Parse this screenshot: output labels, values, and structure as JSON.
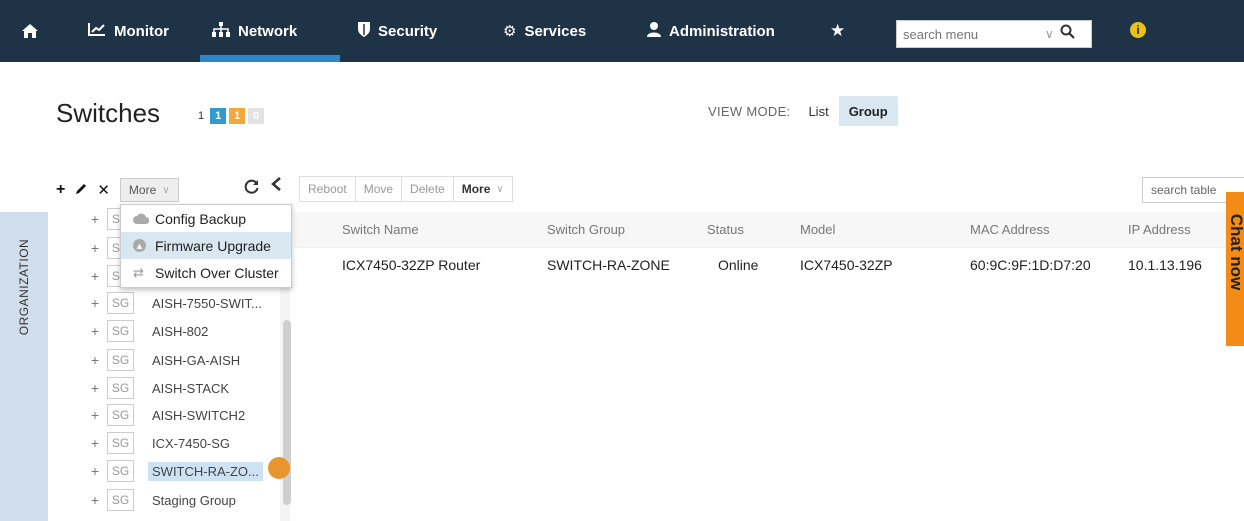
{
  "nav": {
    "home_icon": "home-icon",
    "items": [
      {
        "label": "Monitor",
        "icon": "line-chart-icon"
      },
      {
        "label": "Network",
        "icon": "sitemap-icon"
      },
      {
        "label": "Security",
        "icon": "shield-icon"
      },
      {
        "label": "Services",
        "icon": "gears-icon"
      },
      {
        "label": "Administration",
        "icon": "user-icon"
      }
    ],
    "favorites_icon": "star-icon",
    "search_placeholder": "search menu",
    "info_icon": "info-icon",
    "active": "Network"
  },
  "header": {
    "title": "Switches",
    "counts": [
      "1",
      "1",
      "1",
      "0"
    ],
    "view_mode_label": "VIEW MODE:",
    "view_modes": [
      "List",
      "Group"
    ],
    "selected_view_mode": "Group"
  },
  "left_toolbar": {
    "more_label": "More"
  },
  "menu": {
    "items": [
      {
        "label": "Config Backup",
        "icon": "cloud-icon"
      },
      {
        "label": "Firmware Upgrade",
        "icon": "upgrade-circle-icon"
      },
      {
        "label": "Switch Over Cluster",
        "icon": "switch-arrows-icon"
      }
    ],
    "highlighted": "Firmware Upgrade"
  },
  "sidebar": {
    "tab_label": "ORGANIZATION",
    "tree": [
      {
        "badge": "SG",
        "name": ""
      },
      {
        "badge": "SG",
        "name": ""
      },
      {
        "badge": "SG",
        "name": ""
      },
      {
        "badge": "SG",
        "name": "AISH-7550-SWIT..."
      },
      {
        "badge": "SG",
        "name": "AISH-802"
      },
      {
        "badge": "SG",
        "name": "AISH-GA-AISH"
      },
      {
        "badge": "SG",
        "name": "AISH-STACK"
      },
      {
        "badge": "SG",
        "name": "AISH-SWITCH2"
      },
      {
        "badge": "SG",
        "name": "ICX-7450-SG"
      },
      {
        "badge": "SG",
        "name": "SWITCH-RA-ZO..."
      },
      {
        "badge": "SG",
        "name": "Staging Group"
      }
    ],
    "selected": "SWITCH-RA-ZO..."
  },
  "right_toolbar": {
    "buttons": [
      "Reboot",
      "Move",
      "Delete"
    ],
    "more_label": "More",
    "search_placeholder": "search table"
  },
  "table": {
    "columns": [
      "Switch Name",
      "Switch Group",
      "Status",
      "Model",
      "MAC Address",
      "IP Address"
    ],
    "rows": [
      [
        "ICX7450-32ZP Router",
        "SWITCH-RA-ZONE",
        "Online",
        "ICX7450-32ZP",
        "60:9C:9F:1D:D7:20",
        "10.1.13.196"
      ]
    ]
  },
  "chat": {
    "label": "Chat now"
  },
  "colors": {
    "nav_bg": "#1f3347",
    "accent": "#2f86c8",
    "selected_bg": "#d9e7f1",
    "chat": "#f28c16"
  }
}
